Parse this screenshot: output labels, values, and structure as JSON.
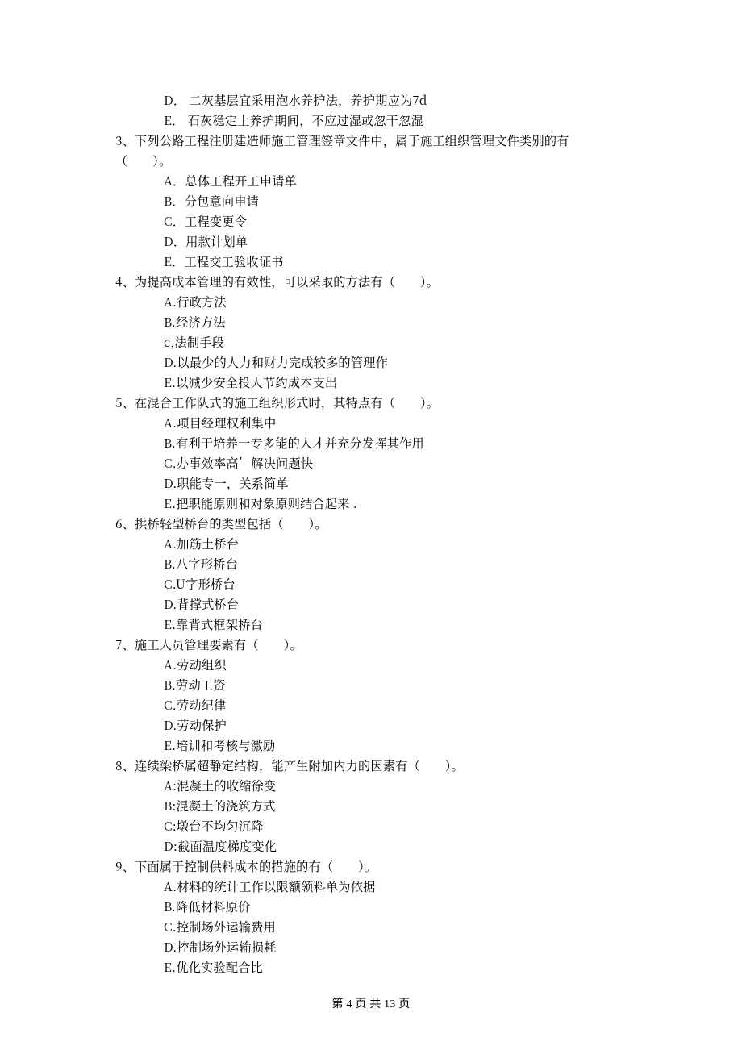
{
  "preOptions": [
    "D． 二灰基层宜采用泡水养护法，养护期应为7d",
    "E． 石灰稳定土养护期间，不应过湿或忽干忽湿"
  ],
  "questions": [
    {
      "number": "3",
      "stem_line1": "3、下列公路工程注册建造师施工管理签章文件中，属于施工组织管理文件类别的有",
      "stem_line2": "（　　）。",
      "options": [
        "A．总体工程开工申请单",
        "B．分包意向申请",
        "C．工程变更令",
        "D．用款计划单",
        "E．工程交工验收证书"
      ]
    },
    {
      "number": "4",
      "stem_line1": "4、为提高成本管理的有效性，可以采取的方法有（　　）。",
      "options": [
        "A.行政方法",
        "B.经济方法",
        "c,法制手段",
        "D.以最少的人力和财力完成较多的管理作",
        "E.以减少安全投人节约成本支出"
      ]
    },
    {
      "number": "5",
      "stem_line1": "5、在混合工作队式的施工组织形式时，其特点有（　　）。",
      "options": [
        "A.项目经理权利集中",
        "B.有利于培养一专多能的人才并充分发挥其作用",
        "C.办事效率高’解决问题快",
        "D.职能专一，关系简单",
        "E.把职能原则和对象原则结合起来 ."
      ]
    },
    {
      "number": "6",
      "stem_line1": "6、拱桥轻型桥台的类型包括（　　）。",
      "options": [
        "A.加筋土桥台",
        "B.八字形桥台",
        "C.U字形桥台",
        "D.背撑式桥台",
        "E.靠背式框架桥台"
      ]
    },
    {
      "number": "7",
      "stem_line1": "7、施工人员管理要素有（　　）。",
      "options": [
        "A.劳动组织",
        "B.劳动工资",
        "C.劳动纪律",
        "D.劳动保护",
        "E.培训和考核与激励"
      ]
    },
    {
      "number": "8",
      "stem_line1": "8、连续梁桥属超静定结构，能产生附加内力的因素有（　　）。",
      "options": [
        "A:混凝土的收缩徐变",
        "B:混凝土的浇筑方式",
        "C:墩台不均匀沉降",
        "D:截面温度梯度变化"
      ]
    },
    {
      "number": "9",
      "stem_line1": "9、下面属于控制供料成本的措施的有（　　）。",
      "options": [
        "A.材料的统计工作以限额领料单为依据",
        "B.降低材料原价",
        "C.控制场外运输费用",
        "D.控制场外运输损耗",
        "E.优化实验配合比"
      ]
    }
  ],
  "footer": {
    "page_current": "4",
    "page_total": "13",
    "prefix": "第 ",
    "middle": " 页 共 ",
    "suffix": " 页"
  }
}
